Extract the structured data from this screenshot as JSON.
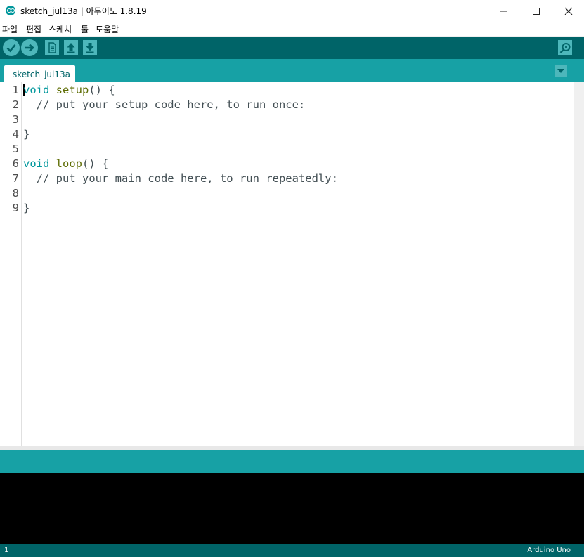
{
  "window": {
    "title": "sketch_jul13a | 아두이노 1.8.19"
  },
  "menu": [
    "파일",
    "편집",
    "스케치",
    "툴",
    "도움말"
  ],
  "tabs": [
    {
      "label": "sketch_jul13a"
    }
  ],
  "editor": {
    "lines": [
      {
        "num": "1",
        "tokens": [
          {
            "t": "void",
            "c": "kw"
          },
          {
            "t": " ",
            "c": ""
          },
          {
            "t": "setup",
            "c": "fn"
          },
          {
            "t": "() {",
            "c": ""
          }
        ]
      },
      {
        "num": "2",
        "tokens": [
          {
            "t": "  // put your setup code here, to run once:",
            "c": ""
          }
        ]
      },
      {
        "num": "3",
        "tokens": []
      },
      {
        "num": "4",
        "tokens": [
          {
            "t": "}",
            "c": ""
          }
        ]
      },
      {
        "num": "5",
        "tokens": []
      },
      {
        "num": "6",
        "tokens": [
          {
            "t": "void",
            "c": "kw"
          },
          {
            "t": " ",
            "c": ""
          },
          {
            "t": "loop",
            "c": "fn"
          },
          {
            "t": "() {",
            "c": ""
          }
        ]
      },
      {
        "num": "7",
        "tokens": [
          {
            "t": "  // put your main code here, to run repeatedly:",
            "c": ""
          }
        ]
      },
      {
        "num": "8",
        "tokens": []
      },
      {
        "num": "9",
        "tokens": [
          {
            "t": "}",
            "c": ""
          }
        ]
      }
    ]
  },
  "footer": {
    "line_number": "1",
    "board": "Arduino Uno"
  },
  "colors": {
    "teal_dark": "#006468",
    "teal": "#17a1a5",
    "button": "#4db7bb",
    "keyword": "#00979c",
    "function": "#5e6d03"
  }
}
